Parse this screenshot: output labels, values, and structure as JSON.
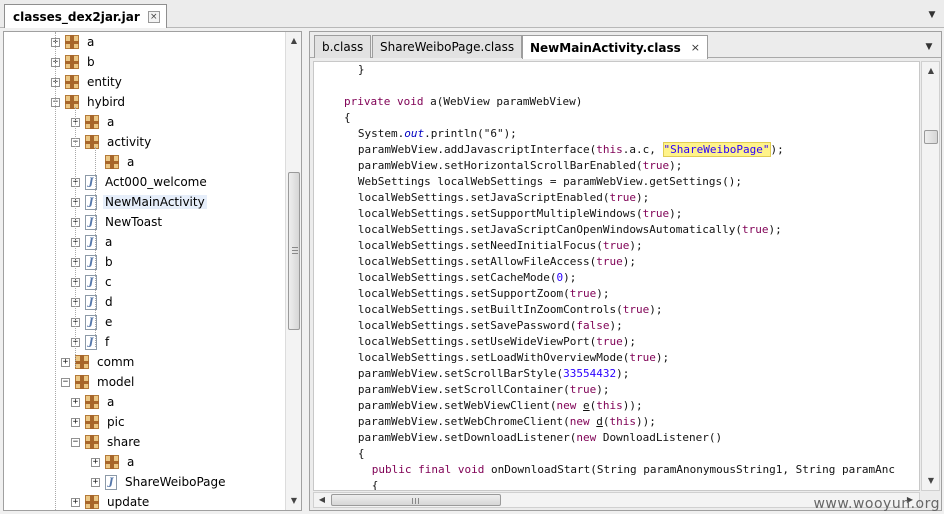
{
  "file_tab": {
    "title": "classes_dex2jar.jar",
    "close": "×"
  },
  "tree": {
    "items": [
      {
        "label": "a",
        "icon": "package-icon",
        "twisty": "+",
        "indent": 0
      },
      {
        "label": "b",
        "icon": "package-icon",
        "twisty": "+",
        "indent": 0
      },
      {
        "label": "entity",
        "icon": "package-icon",
        "twisty": "+",
        "indent": 0
      },
      {
        "label": "hybird",
        "icon": "package-icon",
        "twisty": "-",
        "indent": 0
      },
      {
        "label": "a",
        "icon": "package-icon",
        "twisty": "+",
        "indent": 1
      },
      {
        "label": "activity",
        "icon": "package-icon",
        "twisty": "-",
        "indent": 1
      },
      {
        "label": "a",
        "icon": "package-icon",
        "twisty": "",
        "indent": 2
      },
      {
        "label": "Act000_welcome",
        "icon": "java-file-icon",
        "twisty": "+",
        "indent": 1
      },
      {
        "label": "NewMainActivity",
        "icon": "java-file-icon",
        "twisty": "+",
        "indent": 1,
        "selected": true
      },
      {
        "label": "NewToast",
        "icon": "java-file-icon",
        "twisty": "+",
        "indent": 1
      },
      {
        "label": "a",
        "icon": "java-file-icon",
        "twisty": "+",
        "indent": 1
      },
      {
        "label": "b",
        "icon": "java-file-icon",
        "twisty": "+",
        "indent": 1
      },
      {
        "label": "c",
        "icon": "java-file-icon",
        "twisty": "+",
        "indent": 1
      },
      {
        "label": "d",
        "icon": "java-file-icon",
        "twisty": "+",
        "indent": 1
      },
      {
        "label": "e",
        "icon": "java-file-icon",
        "twisty": "+",
        "indent": 1
      },
      {
        "label": "f",
        "icon": "java-file-icon",
        "twisty": "+",
        "indent": 1
      },
      {
        "label": "comm",
        "icon": "package-icon",
        "twisty": "+",
        "indent": 0.5
      },
      {
        "label": "model",
        "icon": "package-icon",
        "twisty": "-",
        "indent": 0.5
      },
      {
        "label": "a",
        "icon": "package-icon",
        "twisty": "+",
        "indent": 1
      },
      {
        "label": "pic",
        "icon": "package-icon",
        "twisty": "+",
        "indent": 1
      },
      {
        "label": "share",
        "icon": "package-icon",
        "twisty": "-",
        "indent": 1
      },
      {
        "label": "a",
        "icon": "package-icon",
        "twisty": "+",
        "indent": 2
      },
      {
        "label": "ShareWeiboPage",
        "icon": "java-file-icon",
        "twisty": "+",
        "indent": 2
      },
      {
        "label": "update",
        "icon": "package-icon",
        "twisty": "+",
        "indent": 1
      }
    ]
  },
  "editor_tabs": [
    {
      "label": "b.class",
      "active": false
    },
    {
      "label": "ShareWeiboPage.class",
      "active": false
    },
    {
      "label": "NewMainActivity.class",
      "active": true,
      "close": "×"
    }
  ],
  "code_lines": [
    {
      "indent": 2,
      "tokens": [
        [
          "t",
          "}"
        ]
      ]
    },
    {
      "indent": 0,
      "tokens": [
        [
          "t",
          ""
        ]
      ]
    },
    {
      "indent": 0,
      "tokens": [
        [
          "kw",
          "private"
        ],
        [
          "t",
          " "
        ],
        [
          "kw",
          "void"
        ],
        [
          "t",
          " a(WebView paramWebView)"
        ]
      ]
    },
    {
      "indent": 0,
      "tokens": [
        [
          "t",
          "{"
        ]
      ]
    },
    {
      "indent": 2,
      "tokens": [
        [
          "t",
          "System."
        ],
        [
          "it",
          "out"
        ],
        [
          "t",
          ".println(\"6\");"
        ]
      ]
    },
    {
      "indent": 2,
      "tokens": [
        [
          "t",
          "paramWebView.addJavascriptInterface("
        ],
        [
          "kw",
          "this"
        ],
        [
          "t",
          ".a.c, "
        ],
        [
          "hl",
          "\"ShareWeiboPage\""
        ],
        [
          "t",
          ");"
        ]
      ]
    },
    {
      "indent": 2,
      "tokens": [
        [
          "t",
          "paramWebView.setHorizontalScrollBarEnabled("
        ],
        [
          "kw",
          "true"
        ],
        [
          "t",
          ");"
        ]
      ]
    },
    {
      "indent": 2,
      "tokens": [
        [
          "t",
          "WebSettings localWebSettings = paramWebView.getSettings();"
        ]
      ]
    },
    {
      "indent": 2,
      "tokens": [
        [
          "t",
          "localWebSettings.setJavaScriptEnabled("
        ],
        [
          "kw",
          "true"
        ],
        [
          "t",
          ");"
        ]
      ]
    },
    {
      "indent": 2,
      "tokens": [
        [
          "t",
          "localWebSettings.setSupportMultipleWindows("
        ],
        [
          "kw",
          "true"
        ],
        [
          "t",
          ");"
        ]
      ]
    },
    {
      "indent": 2,
      "tokens": [
        [
          "t",
          "localWebSettings.setJavaScriptCanOpenWindowsAutomatically("
        ],
        [
          "kw",
          "true"
        ],
        [
          "t",
          ");"
        ]
      ]
    },
    {
      "indent": 2,
      "tokens": [
        [
          "t",
          "localWebSettings.setNeedInitialFocus("
        ],
        [
          "kw",
          "true"
        ],
        [
          "t",
          ");"
        ]
      ]
    },
    {
      "indent": 2,
      "tokens": [
        [
          "t",
          "localWebSettings.setAllowFileAccess("
        ],
        [
          "kw",
          "true"
        ],
        [
          "t",
          ");"
        ]
      ]
    },
    {
      "indent": 2,
      "tokens": [
        [
          "t",
          "localWebSettings.setCacheMode("
        ],
        [
          "num",
          "0"
        ],
        [
          "t",
          ");"
        ]
      ]
    },
    {
      "indent": 2,
      "tokens": [
        [
          "t",
          "localWebSettings.setSupportZoom("
        ],
        [
          "kw",
          "true"
        ],
        [
          "t",
          ");"
        ]
      ]
    },
    {
      "indent": 2,
      "tokens": [
        [
          "t",
          "localWebSettings.setBuiltInZoomControls("
        ],
        [
          "kw",
          "true"
        ],
        [
          "t",
          ");"
        ]
      ]
    },
    {
      "indent": 2,
      "tokens": [
        [
          "t",
          "localWebSettings.setSavePassword("
        ],
        [
          "kw",
          "false"
        ],
        [
          "t",
          ");"
        ]
      ]
    },
    {
      "indent": 2,
      "tokens": [
        [
          "t",
          "localWebSettings.setUseWideViewPort("
        ],
        [
          "kw",
          "true"
        ],
        [
          "t",
          ");"
        ]
      ]
    },
    {
      "indent": 2,
      "tokens": [
        [
          "t",
          "localWebSettings.setLoadWithOverviewMode("
        ],
        [
          "kw",
          "true"
        ],
        [
          "t",
          ");"
        ]
      ]
    },
    {
      "indent": 2,
      "tokens": [
        [
          "t",
          "paramWebView.setScrollBarStyle("
        ],
        [
          "num",
          "33554432"
        ],
        [
          "t",
          ");"
        ]
      ]
    },
    {
      "indent": 2,
      "tokens": [
        [
          "t",
          "paramWebView.setScrollContainer("
        ],
        [
          "kw",
          "true"
        ],
        [
          "t",
          ");"
        ]
      ]
    },
    {
      "indent": 2,
      "tokens": [
        [
          "t",
          "paramWebView.setWebViewClient("
        ],
        [
          "kw",
          "new"
        ],
        [
          "t",
          " "
        ],
        [
          "ul",
          "e"
        ],
        [
          "t",
          "("
        ],
        [
          "kw",
          "this"
        ],
        [
          "t",
          "));"
        ]
      ]
    },
    {
      "indent": 2,
      "tokens": [
        [
          "t",
          "paramWebView.setWebChromeClient("
        ],
        [
          "kw",
          "new"
        ],
        [
          "t",
          " "
        ],
        [
          "ul",
          "d"
        ],
        [
          "t",
          "("
        ],
        [
          "kw",
          "this"
        ],
        [
          "t",
          "));"
        ]
      ]
    },
    {
      "indent": 2,
      "tokens": [
        [
          "t",
          "paramWebView.setDownloadListener("
        ],
        [
          "kw",
          "new"
        ],
        [
          "t",
          " DownloadListener()"
        ]
      ]
    },
    {
      "indent": 2,
      "tokens": [
        [
          "t",
          "{"
        ]
      ]
    },
    {
      "indent": 4,
      "tokens": [
        [
          "kw",
          "public"
        ],
        [
          "t",
          " "
        ],
        [
          "kw",
          "final"
        ],
        [
          "t",
          " "
        ],
        [
          "kw",
          "void"
        ],
        [
          "t",
          " onDownloadStart(String paramAnonymousString1, String paramAnc"
        ]
      ]
    },
    {
      "indent": 4,
      "tokens": [
        [
          "t",
          "{"
        ]
      ]
    }
  ],
  "scroll_arrows": {
    "up": "▲",
    "down": "▼",
    "left": "◀",
    "right": "▶",
    "menu": "▼"
  },
  "watermark": "www.wooyun.org"
}
